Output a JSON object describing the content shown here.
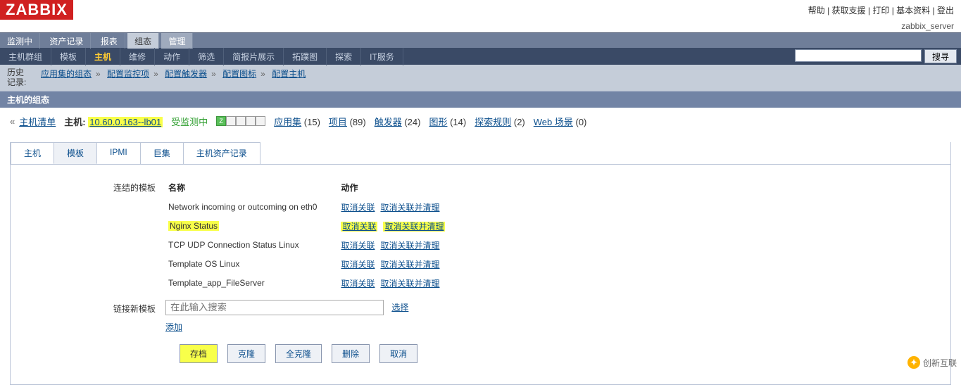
{
  "logo": "ZABBIX",
  "top_links": [
    "帮助",
    "获取支援",
    "打印",
    "基本资料",
    "登出"
  ],
  "server_label": "zabbix_server",
  "menu1": [
    {
      "label": "监测中"
    },
    {
      "label": "资产记录"
    },
    {
      "label": "报表"
    },
    {
      "label": "组态",
      "selected": true
    },
    {
      "label": "管理"
    }
  ],
  "menu2": [
    {
      "label": "主机群组"
    },
    {
      "label": "模板"
    },
    {
      "label": "主机",
      "selected": true
    },
    {
      "label": "维修"
    },
    {
      "label": "动作"
    },
    {
      "label": "筛选"
    },
    {
      "label": "简报片展示"
    },
    {
      "label": "拓蹼图"
    },
    {
      "label": "探索"
    },
    {
      "label": "IT服务"
    }
  ],
  "search_button": "搜寻",
  "history_label": "历史记录:",
  "breadcrumbs": [
    "应用集的组态",
    "配置监控项",
    "配置触发器",
    "配置图标",
    "配置主机"
  ],
  "section_title": "主机的组态",
  "host_bar": {
    "back_link": "主机清单",
    "host_label": "主机:",
    "host_value": "10.60.0.163--lb01",
    "status": "受监测中",
    "indicators": [
      "Z",
      "",
      "",
      "",
      ""
    ],
    "counters": [
      {
        "label": "应用集",
        "count": "(15)"
      },
      {
        "label": "项目",
        "count": "(89)"
      },
      {
        "label": "触发器",
        "count": "(24)"
      },
      {
        "label": "图形",
        "count": "(14)"
      },
      {
        "label": "探索规则",
        "count": "(2)"
      },
      {
        "label": "Web 场景",
        "count": "(0)"
      }
    ]
  },
  "tabs": [
    {
      "label": "主机"
    },
    {
      "label": "模板",
      "selected": true
    },
    {
      "label": "IPMI"
    },
    {
      "label": "巨集"
    },
    {
      "label": "主机资产记录"
    }
  ],
  "linked": {
    "label": "连结的模板",
    "col_name": "名称",
    "col_action": "动作",
    "rows": [
      {
        "name": "Network incoming or outcoming on eth0",
        "a1": "取消关联",
        "a2": "取消关联并清理"
      },
      {
        "name": "Nginx Status",
        "a1": "取消关联",
        "a2": "取消关联并清理",
        "hl": true
      },
      {
        "name": "TCP UDP Connection Status Linux",
        "a1": "取消关联",
        "a2": "取消关联并清理"
      },
      {
        "name": "Template OS Linux",
        "a1": "取消关联",
        "a2": "取消关联并清理"
      },
      {
        "name": "Template_app_FileServer",
        "a1": "取消关联",
        "a2": "取消关联并清理"
      }
    ]
  },
  "link_new": {
    "label": "链接新模板",
    "placeholder": "在此输入搜索",
    "select": "选择",
    "add": "添加"
  },
  "buttons": {
    "archive": "存档",
    "clone": "克隆",
    "full_clone": "全克隆",
    "delete": "删除",
    "cancel": "取消"
  },
  "watermark": "创新互联"
}
